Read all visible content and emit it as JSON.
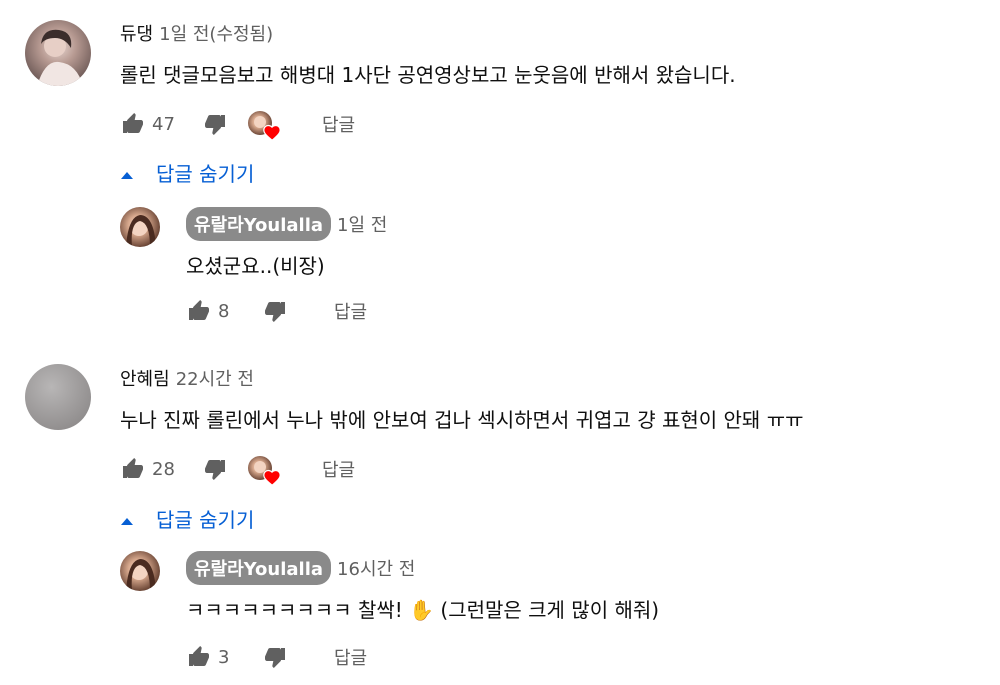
{
  "comments": [
    {
      "author": "듀댕",
      "meta": "1일 전(수정됨)",
      "text": "롤린 댓글모음보고 해병대 1사단 공연영상보고 눈웃음에 반해서 왔습니다.",
      "likes": "47",
      "reply_label": "답글",
      "hide_replies_label": "답글 숨기기",
      "reply": {
        "author": "유랄라Youlalla",
        "meta": "1일 전",
        "text": "오셨군요..(비장)",
        "likes": "8",
        "reply_label": "답글"
      }
    },
    {
      "author": "안혜림",
      "meta": "22시간 전",
      "text": "누나 진짜 롤린에서 누나 밖에 안보여 겁나 섹시하면서 귀엽고 걍 표현이 안돼 ㅠㅠ",
      "likes": "28",
      "reply_label": "답글",
      "hide_replies_label": "답글 숨기기",
      "reply": {
        "author": "유랄라Youlalla",
        "meta": "16시간 전",
        "text": "ㅋㅋㅋㅋㅋㅋㅋㅋㅋ 찰싹! ✋ (그런말은 크게 많이 해줘)",
        "likes": "3",
        "reply_label": "답글"
      }
    }
  ],
  "icons": {
    "like": "thumb-up-icon",
    "dislike": "thumb-down-icon",
    "creator_heart": "creator-heart-icon",
    "collapse": "arrow-up-icon"
  },
  "colors": {
    "link": "#065fd4",
    "meta": "#606060",
    "heart": "#ff0000",
    "author_chip": "#8a8a8a"
  }
}
